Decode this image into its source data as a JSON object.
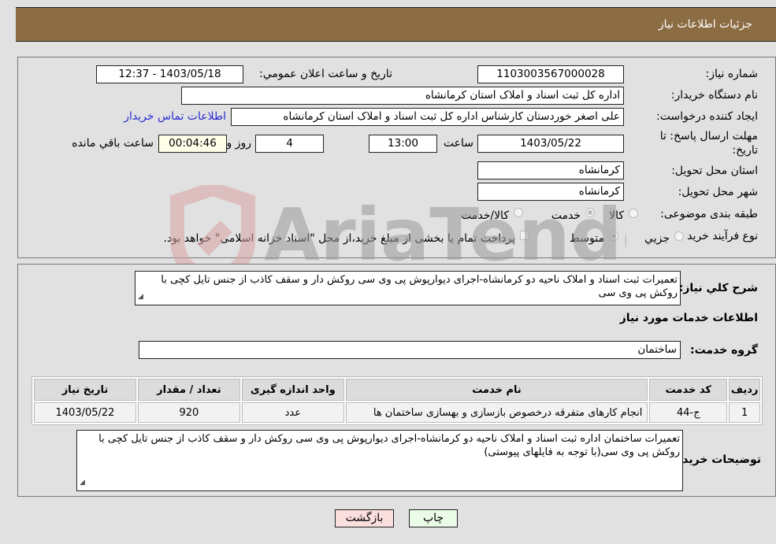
{
  "header": {
    "title": "جزئیات اطلاعات نیاز"
  },
  "form": {
    "need_number": {
      "label": "شماره نیاز:",
      "value": "1103003567000028"
    },
    "announce_datetime": {
      "label": "تاریخ و ساعت اعلان عمومي:",
      "value": "1403/05/18 - 12:37"
    },
    "buyer_org": {
      "label": "نام دستگاه خریدار:",
      "value": "اداره کل ثبت اسناد و املاک استان کرمانشاه"
    },
    "requester": {
      "label": "ایجاد کننده درخواست:",
      "value": "علی اصغر خوردستان کارشناس اداره کل ثبت اسناد و املاک استان کرمانشاه"
    },
    "buyer_contact_link": "اطلاعات تماس خریدار",
    "deadline": {
      "label_line1": "مهلت ارسال پاسخ: تا",
      "label_line2": "تاریخ:",
      "date": "1403/05/22",
      "time_label": "ساعت",
      "time": "13:00",
      "days": "4",
      "days_label": "روز و",
      "remaining": "00:04:46",
      "remaining_label": "ساعت باقي مانده"
    },
    "delivery_province": {
      "label": "استان محل تحویل:",
      "value": "کرمانشاه"
    },
    "delivery_city": {
      "label": "شهر محل تحویل:",
      "value": "کرمانشاه"
    },
    "category": {
      "label": "طبقه بندی موضوعی:",
      "options": [
        {
          "label": "کالا",
          "checked": false
        },
        {
          "label": "خدمت",
          "checked": true
        },
        {
          "label": "کالا/خدمت",
          "checked": false
        }
      ]
    },
    "purchase_type": {
      "label": "نوع فرآیند خرید :",
      "options": [
        {
          "label": "جزيي",
          "checked": false
        },
        {
          "label": "متوسط",
          "checked": true
        }
      ],
      "treasury_checkbox_text": "پرداخت تمام یا بخشی از مبلغ خرید،از محل \"اسناد خزانه اسلامی\" خواهد بود.",
      "treasury_checked": false
    }
  },
  "details": {
    "summary_label": "شرح کلي نیاز:",
    "summary_value": "تعمیرات ثبت اسناد و املاک ناحیه دو کرمانشاه-اجرای دیوارپوش پی وی سی روکش دار و سقف کاذب از جنس تایل کچی با روکش پی وی سی",
    "services_heading": "اطلاعات خدمات مورد نیاز",
    "service_group_label": "گروه خدمت:",
    "service_group_value": "ساختمان",
    "table": {
      "headers": [
        "ردیف",
        "کد خدمت",
        "نام خدمت",
        "واحد اندازه گیری",
        "تعداد / مقدار",
        "تاریخ نیاز"
      ],
      "rows": [
        [
          "1",
          "ج-44",
          "انجام کارهای متفرقه درخصوص بازسازی و بهسازی ساختمان ها",
          "عدد",
          "920",
          "1403/05/22"
        ]
      ]
    },
    "buyer_notes_label": "توضیحات خریدار:",
    "buyer_notes_value": "تعمیرات ساختمان اداره ثبت اسناد و املاک ناحیه دو کرمانشاه-اجرای دیوارپوش پی وی سی روکش دار و سقف کاذب از جنس تایل کچی با روکش پی وی سی(با توجه به فایلهای پیوستی)"
  },
  "buttons": {
    "print": "چاپ",
    "back": "بازگشت"
  },
  "watermark": "AriaTender.neT"
}
